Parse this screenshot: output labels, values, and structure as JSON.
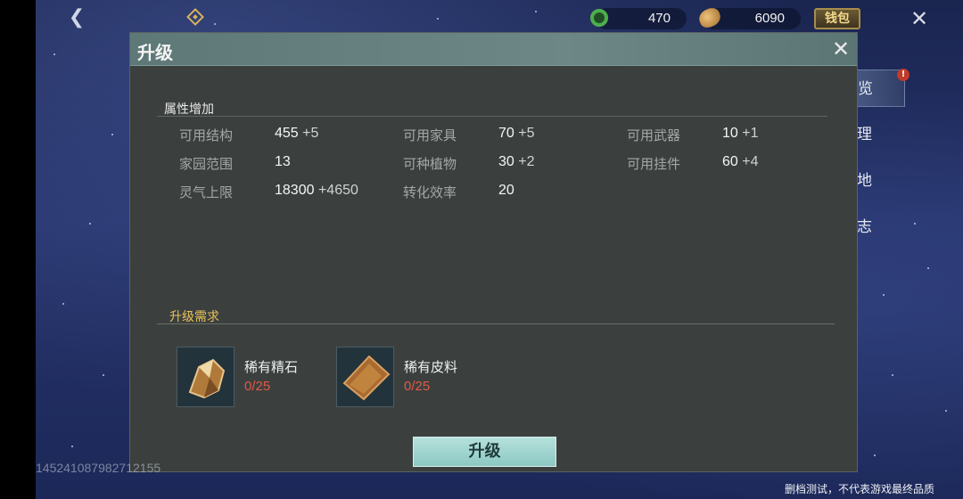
{
  "topbar": {
    "back_icon": "chevron-left-icon",
    "nav_icon": "diamond-icon",
    "jade_amount": "470",
    "gold_amount": "6090",
    "wallet_label": "钱包",
    "close_icon": "close-icon"
  },
  "side_menu": {
    "items": [
      {
        "label": "览"
      },
      {
        "label": "理"
      },
      {
        "label": "地"
      },
      {
        "label": "志"
      }
    ],
    "badge": "!"
  },
  "dialog": {
    "title": "升级",
    "close_label": "✕",
    "attributes_title": "属性增加",
    "attributes": [
      {
        "label": "可用结构",
        "value": "455",
        "bonus": "+5"
      },
      {
        "label": "可用家具",
        "value": "70",
        "bonus": "+5"
      },
      {
        "label": "可用武器",
        "value": "10",
        "bonus": "+1"
      },
      {
        "label": "家园范围",
        "value": "13",
        "bonus": ""
      },
      {
        "label": "可种植物",
        "value": "30",
        "bonus": "+2"
      },
      {
        "label": "可用挂件",
        "value": "60",
        "bonus": "+4"
      },
      {
        "label": "灵气上限",
        "value": "18300",
        "bonus": "+4650"
      },
      {
        "label": "转化效率",
        "value": "20",
        "bonus": ""
      }
    ],
    "requirements_title": "升级需求",
    "requirements": [
      {
        "name": "稀有精石",
        "count": "0/25"
      },
      {
        "name": "稀有皮料",
        "count": "0/25"
      }
    ],
    "upgrade_button": "升级"
  },
  "uid": "1452410879827121 55",
  "uid_text": "145241087982712155",
  "disclaimer": "删档测试，不代表游戏最终品质",
  "colors": {
    "dialog_bg": "#3b403f",
    "header_bg": "#6d8787",
    "req_title": "#e8c25a",
    "count_red": "#e05a44",
    "button_bg": "#a6d8d2"
  }
}
